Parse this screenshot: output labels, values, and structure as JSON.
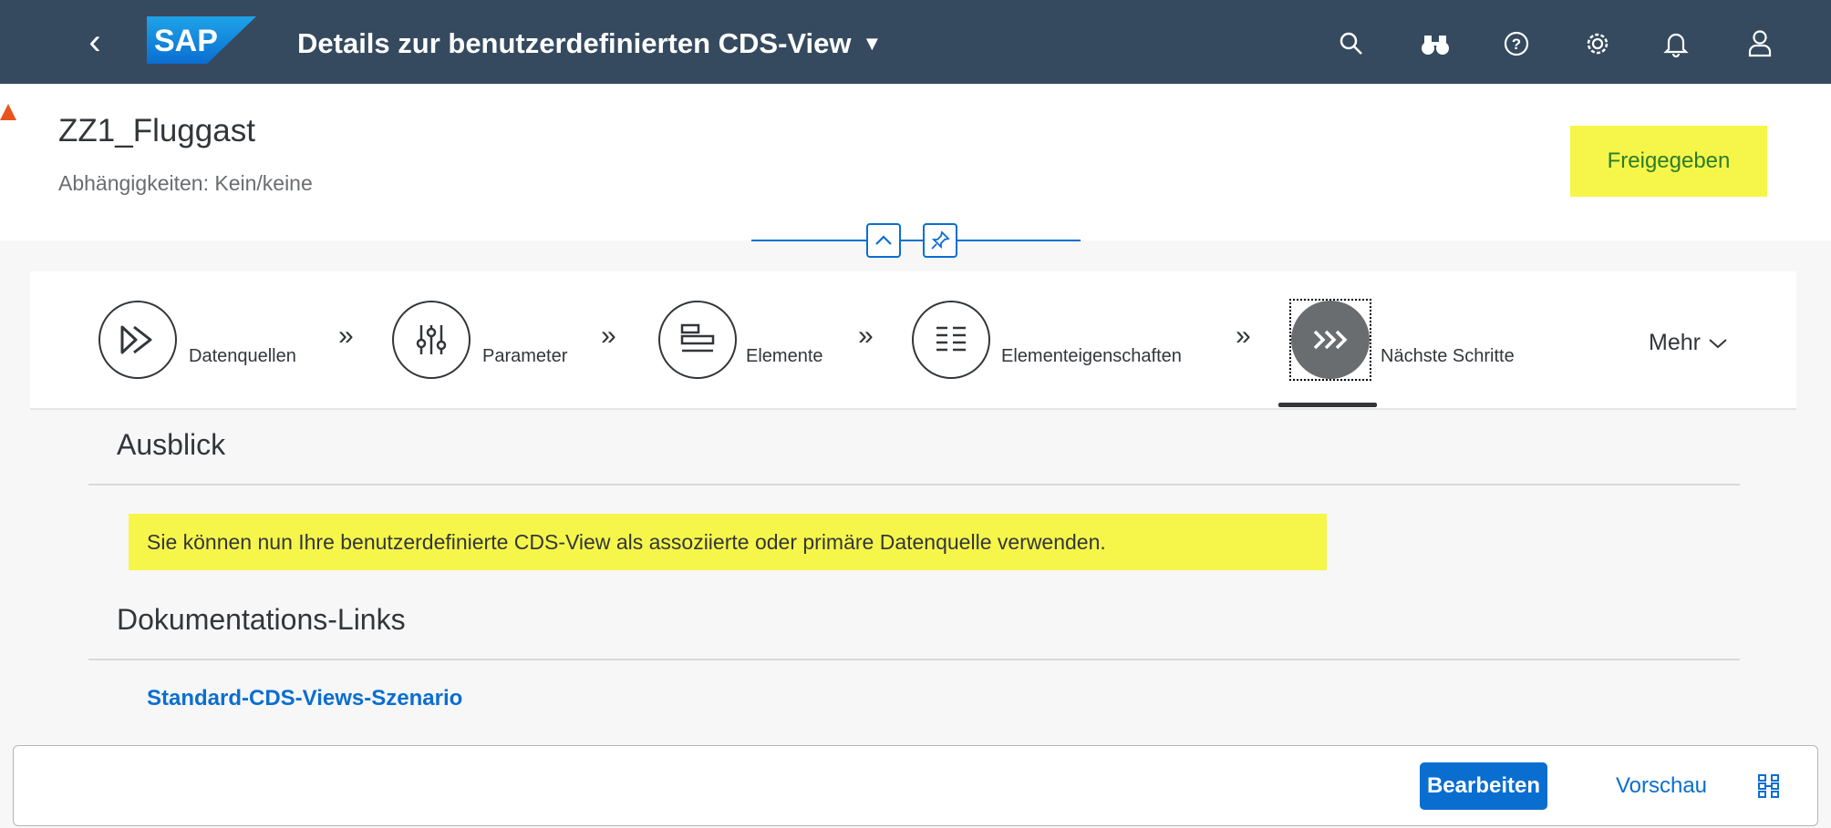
{
  "shell": {
    "title": "Details zur benutzerdefinierten CDS-View",
    "logo_text": "SAP",
    "icons": [
      "back-icon",
      "search-icon",
      "binoculars-icon",
      "help-icon",
      "settings-icon",
      "notification-icon",
      "user-icon"
    ]
  },
  "header": {
    "title": "ZZ1_Fluggast",
    "subtitle": "Abhängigkeiten: Kein/keine",
    "status": "Freigegeben"
  },
  "anchors": [
    {
      "label": "Datenquellen",
      "icon": "fast-forward-icon"
    },
    {
      "label": "Parameter",
      "icon": "sliders-icon"
    },
    {
      "label": "Elemente",
      "icon": "elements-icon"
    },
    {
      "label": "Elementeigenschaften",
      "icon": "list-properties-icon"
    },
    {
      "label": "Nächste Schritte",
      "icon": "next-steps-icon",
      "active": true
    }
  ],
  "more_label": "Mehr",
  "sections": {
    "outlook": {
      "title": "Ausblick",
      "text": "Sie können nun Ihre benutzerdefinierte CDS-View als assoziierte oder primäre Datenquelle verwenden."
    },
    "docs": {
      "title": "Dokumentations-Links",
      "link": "Standard-CDS-Views-Szenario"
    }
  },
  "footer": {
    "edit": "Bearbeiten",
    "preview": "Vorschau"
  },
  "colors": {
    "shell": "#354a5f",
    "accent": "#0a6ed1",
    "highlight": "#f6f64a",
    "status_text": "#2b7d2b"
  }
}
